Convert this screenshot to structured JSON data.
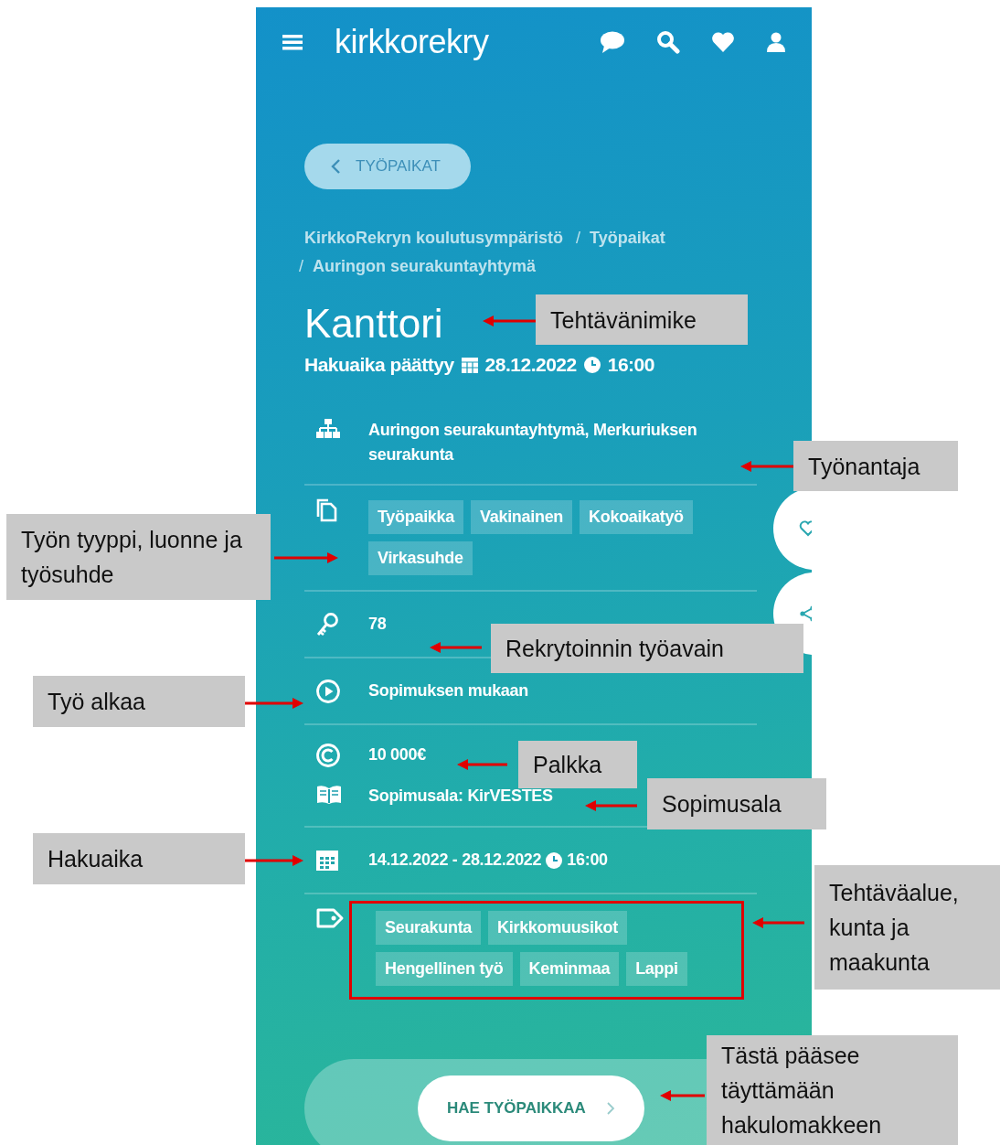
{
  "header": {
    "logo": "kirkkorekry"
  },
  "back_button": {
    "label": "TYÖPAIKAT"
  },
  "breadcrumb": {
    "separator": "/",
    "items": [
      {
        "label": "KirkkoRekryn koulutusympäristö"
      },
      {
        "label": "Työpaikat"
      },
      {
        "label": "Auringon seurakuntayhtymä"
      }
    ]
  },
  "title": "Kanttori",
  "deadline": {
    "label": "Hakuaika päättyy",
    "date": "28.12.2022",
    "time": "16:00"
  },
  "details": [
    {
      "items": [
        {
          "kind": "employer",
          "text": "Auringon seurakuntayhtymä, Merkuriuksen seurakunta"
        }
      ]
    },
    {
      "items": [
        {
          "kind": "job_type",
          "tags": [
            "Työpaikka",
            "Vakinainen",
            "Kokoaikatyö",
            "Virkasuhde"
          ],
          "highlighted": false
        }
      ]
    },
    {
      "items": [
        {
          "kind": "work_key",
          "text": "78"
        }
      ]
    },
    {
      "items": [
        {
          "kind": "start",
          "text": "Sopimuksen mukaan"
        }
      ]
    },
    {
      "items": [
        {
          "kind": "salary",
          "text": "10 000€"
        },
        {
          "kind": "contract",
          "text": "Sopimusala: KirVESTES"
        }
      ]
    },
    {
      "items": [
        {
          "kind": "period",
          "text": "14.12.2022 - 28.12.2022",
          "time": "16:00"
        }
      ]
    },
    {
      "items": [
        {
          "kind": "areas",
          "tags": [
            "Seurakunta",
            "Kirkkomuusikot",
            "Hengellinen työ",
            "Keminmaa",
            "Lappi"
          ],
          "highlighted": true
        }
      ]
    }
  ],
  "apply_button": {
    "label": "HAE TYÖPAIKKAA"
  },
  "annotations": [
    {
      "text": "Tehtävänimike"
    },
    {
      "text": "Työnantaja"
    },
    {
      "text": "Työn tyyppi, luonne ja työsuhde"
    },
    {
      "text": "Rekrytoinnin työavain"
    },
    {
      "text": "Työ alkaa"
    },
    {
      "text": "Palkka"
    },
    {
      "text": "Sopimusala"
    },
    {
      "text": "Hakuaika"
    },
    {
      "text": "Tehtäväalue, kunta ja maakunta"
    },
    {
      "text": "Tästä pääsee täyttämään hakulomakkeen"
    }
  ]
}
